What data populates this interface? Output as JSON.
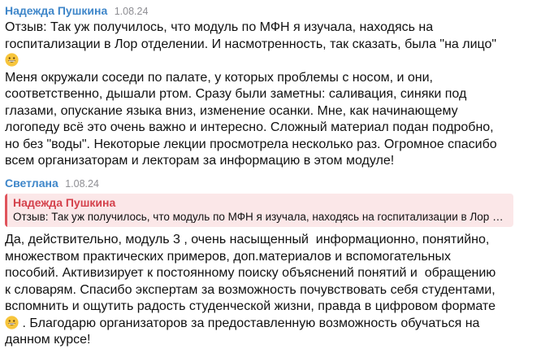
{
  "messages": [
    {
      "author": "Надежда Пушкина",
      "date": "1.08.24",
      "text_part1": "Отзыв: Так уж получилось, что модуль по МФН я изучала, находясь на\nгоспитализации в Лор отделении. И насмотренность, так сказать, была \"на лицо\"\n",
      "emoji": "grinning-face-emoji",
      "text_part2": "\nМеня окружали соседи по палате, у которых проблемы с носом, и они,\nсоответственно, дышали ртом. Сразу были заметны: саливация, синяки под\nглазами, опускание языка вниз, изменение осанки. Мне, как начинающему\nлогопеду всё это очень важно и интересно. Сложный материал подан подробно,\nно без \"воды\". Некоторые лекции просмотрела несколько раз. Огромное спасибо\nвсем организаторам и лекторам за информацию в этом модуле!"
    },
    {
      "author": "Светлана",
      "date": "1.08.24",
      "reply": {
        "author": "Надежда Пушкина",
        "text": "Отзыв: Так уж получилось, что модуль по МФН я изучала, находясь на госпитализации в Лор о..."
      },
      "text_part1": "Да, действительно, модуль 3 , очень насыщенный  информационно, понятийно,\nмножеством практических примеров, доп.материалов и вспомогательных\nпособий. Активизирует к постоянному поиску объяснений понятий и  обращению\nк словарям. Спасибо экспертам за возможность почувствовать себя студентами,\nвспомнить и ощутить радость студенческой жизни, правда в цифровом формате\n",
      "emoji": "grinning-face-emoji",
      "text_part2": " . Благодарю организаторов за предоставленную возможность обучаться на\nданном курсе!"
    }
  ],
  "colors": {
    "author": "#3e86c9",
    "date": "#8e8e93",
    "reply_author": "#d4414b",
    "reply_background": "#fbe7e8",
    "reply_bar": "#e0545c",
    "emoji_face": "#f7c53c"
  }
}
